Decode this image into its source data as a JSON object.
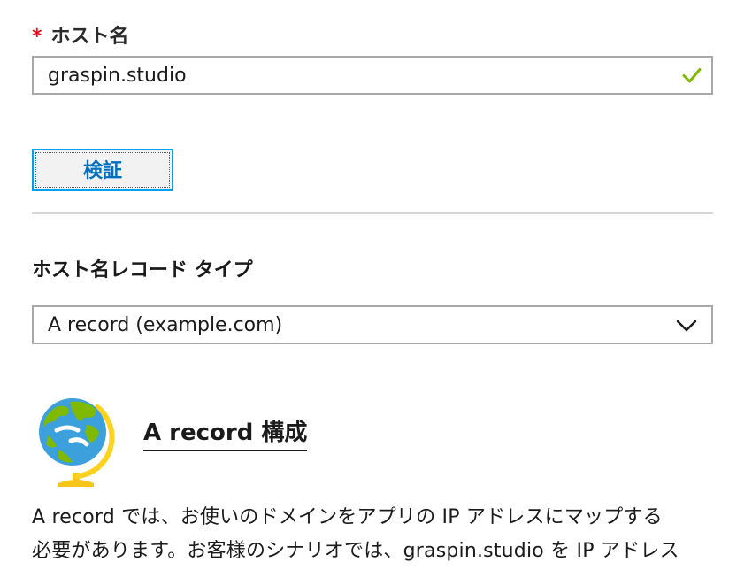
{
  "hostname": {
    "required_mark": "*",
    "label": "ホスト名",
    "value": "graspin.studio",
    "status": "valid"
  },
  "verify": {
    "label": "検証"
  },
  "record_type": {
    "label": "ホスト名レコード タイプ",
    "selected": "A record (example.com)"
  },
  "config": {
    "heading": "A record 構成",
    "description_lines": [
      "A record では、お使いのドメインをアプリの IP アドレスにマップする",
      "必要があります。お客様のシナリオでは、graspin.studio を IP アドレス"
    ]
  },
  "colors": {
    "required": "#e81123",
    "valid_check": "#7fba00",
    "link_blue": "#0070c0",
    "focus_blue": "#00a2ed",
    "border": "#a8a8a8"
  },
  "icons": {
    "valid": "check-icon",
    "dropdown": "chevron-down-icon",
    "config": "globe-icon"
  }
}
